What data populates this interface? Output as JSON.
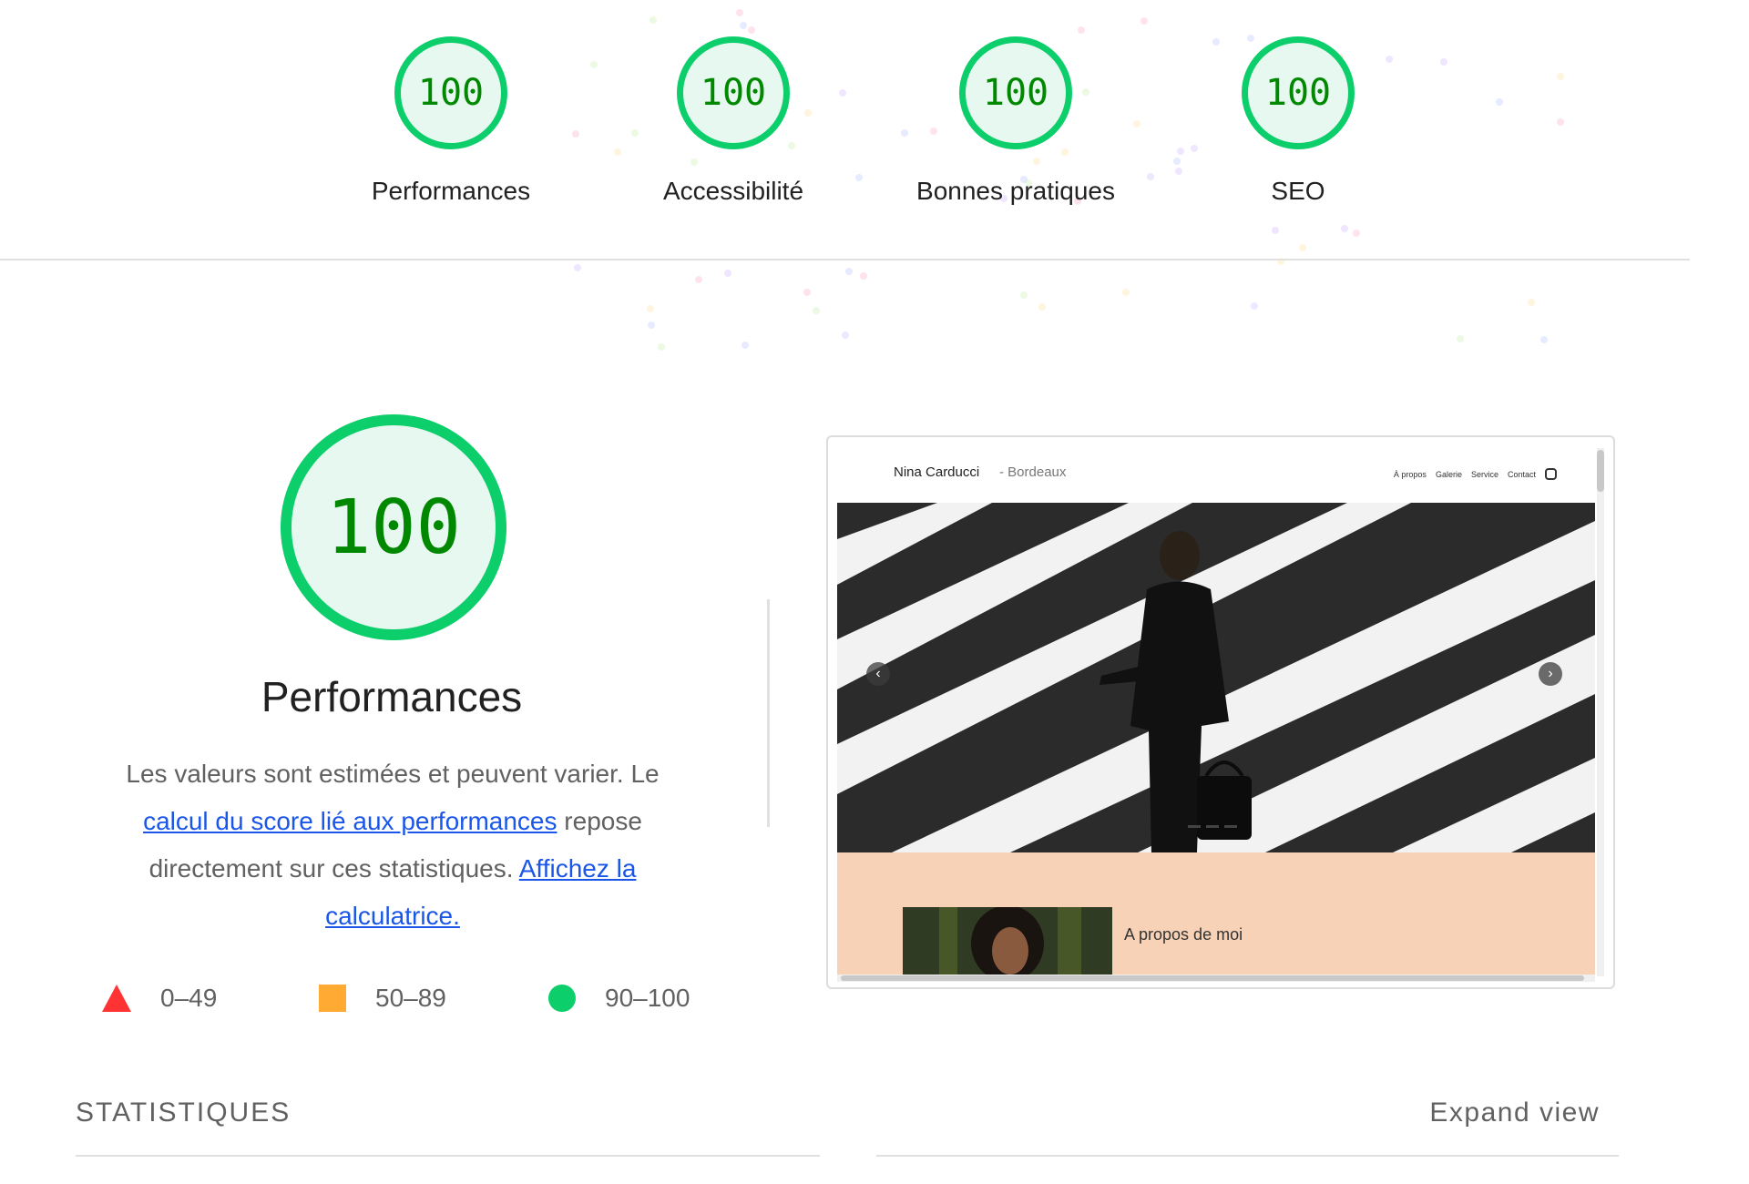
{
  "categories": [
    {
      "label": "Performances",
      "score": "100"
    },
    {
      "label": "Accessibilité",
      "score": "100"
    },
    {
      "label": "Bonnes pratiques",
      "score": "100"
    },
    {
      "label": "SEO",
      "score": "100"
    }
  ],
  "performance": {
    "score": "100",
    "title": "Performances",
    "desc_text_1": "Les valeurs sont estimées et peuvent varier. Le ",
    "desc_link_1": "calcul du score lié aux performances",
    "desc_text_2": " repose directement sur ces statistiques. ",
    "desc_link_2": "Affichez la calculatrice."
  },
  "legend": {
    "fail": "0–49",
    "average": "50–89",
    "pass": "90–100"
  },
  "preview": {
    "site_name": "Nina Carducci",
    "site_city": "- Bordeaux",
    "nav": [
      "À propos",
      "Galerie",
      "Service",
      "Contact"
    ],
    "about_title": "A propos de moi"
  },
  "metrics": {
    "section_title": "STATISTIQUES",
    "expand_label": "Expand view"
  },
  "colors": {
    "pass": "#0cce6b",
    "pass_text": "#008800",
    "average": "#ffaa33",
    "fail": "#ff3333",
    "link": "#1a56e8"
  }
}
